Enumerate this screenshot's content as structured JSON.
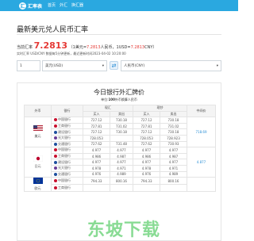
{
  "brand": {
    "logo_glyph": "汇",
    "name": "汇率表"
  },
  "nav": [
    "首页",
    "外汇",
    "换汇器"
  ],
  "page": {
    "title": "最新美元兑人民币汇率",
    "rate_label": "当前汇率",
    "rate_value": "7.2813",
    "rate_desc_prefix": "（1美元=",
    "rate_desc_value": "7.2813",
    "rate_desc_mid": "人民币，1USD=",
    "rate_desc_value2": "7.2813",
    "rate_desc_suffix": "CNY）",
    "update_text": "实时汇率 USD/CNY 数据每5分钟更新，最近更新时间2023-04-02 10:20:00"
  },
  "converter": {
    "amount": "1",
    "from_currency": "美元(USD)",
    "to_currency": "人民币(CNY)",
    "swap_icon": "⇄"
  },
  "board": {
    "title": "今日银行外汇牌价",
    "sub_prefix": "单位:",
    "sub_bold": "100",
    "sub_suffix": "外币换算人民币",
    "col_currency": "外币",
    "col_bank": "银行",
    "col_cash": "现汇",
    "col_spot": "现钞",
    "col_buy": "买入",
    "col_sell": "卖出",
    "col_mid": "中间价",
    "groups": [
      {
        "currency": "美元",
        "mid": "718.69",
        "rows": [
          {
            "bank": "中国银行",
            "color": "#c8102e",
            "v": [
              "727.12",
              "730.18",
              "727.12",
              "730.18"
            ]
          },
          {
            "bank": "工商银行",
            "color": "#c8102e",
            "v": [
              "727.81",
              "731.02",
              "727.81",
              "731.02"
            ]
          },
          {
            "bank": "建设银行",
            "color": "#1d4f9e",
            "v": [
              "727.12",
              "730.18",
              "727.12",
              "730.18"
            ]
          },
          {
            "bank": "光大银行",
            "color": "#6a3c96",
            "v": [
              "728.053",
              "",
              "728.053",
              "728.923"
            ]
          },
          {
            "bank": "交通银行",
            "color": "#1d4f9e",
            "v": [
              "727.62",
              "731.48",
              "727.62",
              "730.93"
            ]
          }
        ]
      },
      {
        "currency": "日元",
        "mid": "4.877",
        "rows": [
          {
            "bank": "中国银行",
            "color": "#c8102e",
            "v": [
              "4.977",
              "4.977",
              "4.977",
              "4.977"
            ]
          },
          {
            "bank": "工商银行",
            "color": "#c8102e",
            "v": [
              "4.986",
              "4.987",
              "4.986",
              "4.987"
            ]
          },
          {
            "bank": "建设银行",
            "color": "#1d4f9e",
            "v": [
              "4.977",
              "4.977",
              "4.977",
              "4.977"
            ]
          },
          {
            "bank": "光大银行",
            "color": "#6a3c96",
            "v": [
              "4.978",
              "4.971",
              "4.978",
              "4.971"
            ]
          },
          {
            "bank": "交通银行",
            "color": "#1d4f9e",
            "v": [
              "4.976",
              "4.989",
              "4.976",
              "4.989"
            ]
          }
        ]
      },
      {
        "currency": "欧元",
        "mid": "",
        "rows": [
          {
            "bank": "中国银行",
            "color": "#c8102e",
            "v": [
              "794.33",
              "800.16",
              "794.33",
              "800.16"
            ]
          },
          {
            "bank": "工商银行",
            "color": "#c8102e",
            "v": [
              "",
              "",
              "",
              ""
            ]
          }
        ]
      }
    ]
  },
  "watermark": "东坡下载"
}
